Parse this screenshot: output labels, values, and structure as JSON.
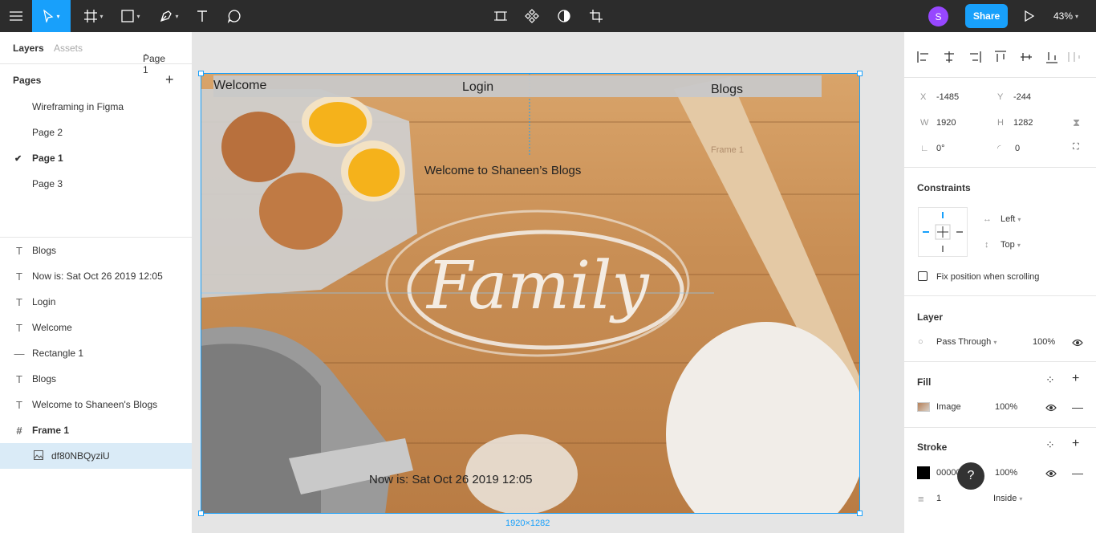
{
  "toolbar": {
    "zoom": "43%",
    "share_label": "Share",
    "avatar_initial": "S"
  },
  "left_panel": {
    "tabs": {
      "layers": "Layers",
      "assets": "Assets",
      "page_selector": "Page 1"
    },
    "pages_heading": "Pages",
    "pages": [
      {
        "label": "Wireframing in Figma",
        "selected": false
      },
      {
        "label": "Page 2",
        "selected": false
      },
      {
        "label": "Page 1",
        "selected": true
      },
      {
        "label": "Page 3",
        "selected": false
      }
    ],
    "layers": [
      {
        "label": "Blogs",
        "icon": "text-icon"
      },
      {
        "label": "Now is: Sat Oct 26 2019 12:05",
        "icon": "text-icon"
      },
      {
        "label": "Login",
        "icon": "text-icon"
      },
      {
        "label": "Welcome",
        "icon": "text-icon"
      },
      {
        "label": "Rectangle 1",
        "icon": "line-icon"
      },
      {
        "label": "Blogs",
        "icon": "text-icon"
      },
      {
        "label": "Welcome to Shaneen's Blogs",
        "icon": "text-icon"
      },
      {
        "label": "Frame 1",
        "icon": "frame-icon"
      },
      {
        "label": "df80NBQyziU",
        "icon": "image-icon"
      }
    ]
  },
  "canvas": {
    "frame_texts": {
      "welcome": "Welcome",
      "login": "Login",
      "blogs": "Blogs",
      "frame_name": "Frame 1",
      "heading": "Welcome to Shaneen’s Blogs",
      "flour_word": "Family",
      "now": "Now is:  Sat Oct 26 2019 12:05"
    },
    "dimensions_label": "1920×1282"
  },
  "right_panel": {
    "x_label": "X",
    "x_value": "-1485",
    "y_label": "Y",
    "y_value": "-244",
    "w_label": "W",
    "w_value": "1920",
    "h_label": "H",
    "h_value": "1282",
    "rotation": "0°",
    "radius": "0",
    "constraints": {
      "heading": "Constraints",
      "horizontal": "Left",
      "vertical": "Top",
      "fix_label": "Fix position when scrolling"
    },
    "layer": {
      "heading": "Layer",
      "blend": "Pass Through",
      "opacity": "100%"
    },
    "fill": {
      "heading": "Fill",
      "type": "Image",
      "opacity": "100%"
    },
    "stroke": {
      "heading": "Stroke",
      "color": "000000",
      "opacity": "100%",
      "weight": "1",
      "position": "Inside"
    }
  },
  "help_label": "?"
}
